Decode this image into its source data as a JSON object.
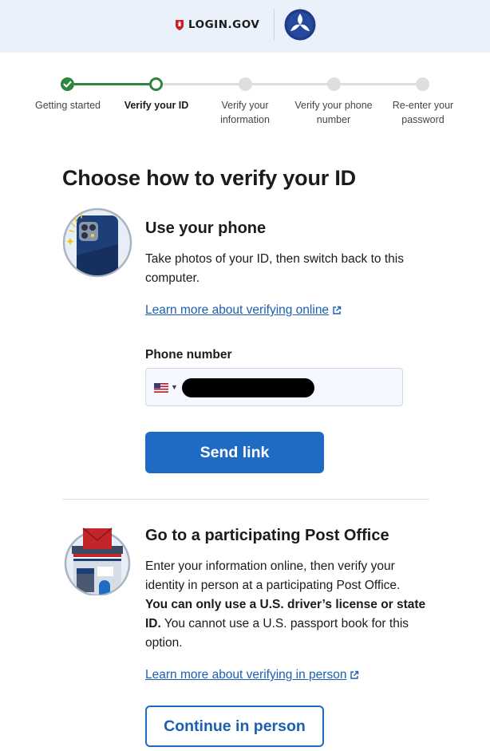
{
  "header": {
    "logo_text": "LOGIN.GOV"
  },
  "stepper": {
    "steps": [
      {
        "label_line1": "Getting started",
        "label_line2": "",
        "status": "complete"
      },
      {
        "label_line1": "Verify your ID",
        "label_line2": "",
        "status": "current"
      },
      {
        "label_line1": "Verify your",
        "label_line2": "information",
        "status": "incomplete"
      },
      {
        "label_line1": "Verify your phone",
        "label_line2": "number",
        "status": "incomplete"
      },
      {
        "label_line1": "Re-enter your",
        "label_line2": "password",
        "status": "incomplete"
      }
    ]
  },
  "page": {
    "title": "Choose how to verify your ID"
  },
  "phone_section": {
    "heading": "Use your phone",
    "body_line1": "Take photos of your ID, then switch back to this",
    "body_line2": "computer.",
    "learn_more_link": "Learn more about verifying online",
    "field_label": "Phone number",
    "country_flag": "us-flag-icon",
    "send_button": "Send link"
  },
  "post_office_section": {
    "heading": "Go to a participating Post Office",
    "body_line1": "Enter your information online, then verify your",
    "body_line2": "identity in person at a participating Post Office.",
    "body_bold_line3": "You can only use a U.S. driver’s license or state",
    "body_bold_line4_start": "ID.",
    "body_line4_rest": " You cannot use a U.S. passport book for this",
    "body_line5": "option.",
    "learn_more_link": "Learn more about verifying in person",
    "continue_button": "Continue in person"
  },
  "colors": {
    "accent": "#1f6bc4",
    "success": "#2e8540",
    "header_bg": "#eaf1fa"
  }
}
